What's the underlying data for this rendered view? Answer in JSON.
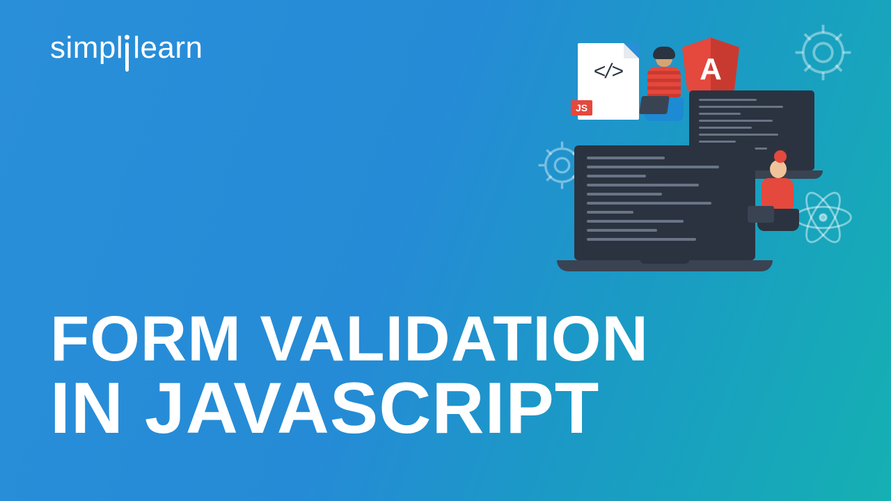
{
  "brand": {
    "name_part1": "simpl",
    "name_part2": "learn"
  },
  "headline": {
    "line1": "Form Validation",
    "line2": "In JavaScript"
  },
  "illustration": {
    "file_badge": "JS",
    "shield_letter": "A",
    "icons": {
      "gear1": "gear-icon",
      "gear2": "gear-icon",
      "atom": "react-atom-icon",
      "shield": "angular-shield-icon",
      "code_file": "code-file-icon"
    }
  }
}
